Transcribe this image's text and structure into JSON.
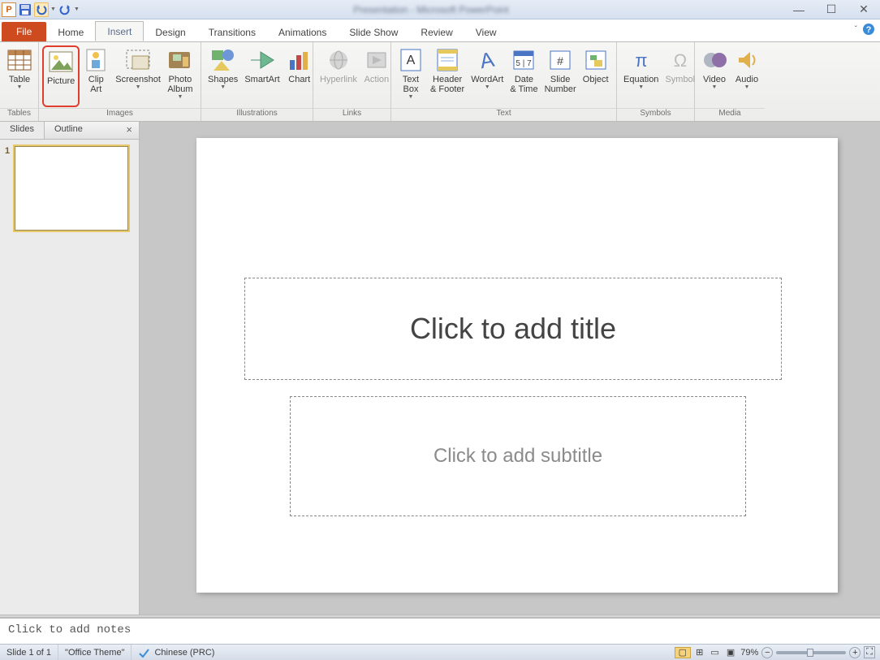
{
  "title_text_blurred": "Presentation - Microsoft PowerPoint",
  "tabs": {
    "file": "File",
    "home": "Home",
    "insert": "Insert",
    "design": "Design",
    "transitions": "Transitions",
    "animations": "Animations",
    "slideshow": "Slide Show",
    "review": "Review",
    "view": "View"
  },
  "ribbon": {
    "groups": {
      "tables": "Tables",
      "images": "Images",
      "illustrations": "Illustrations",
      "links": "Links",
      "text": "Text",
      "symbols": "Symbols",
      "media": "Media"
    },
    "items": {
      "table": "Table",
      "picture": "Picture",
      "clipart": "Clip\nArt",
      "screenshot": "Screenshot",
      "photoalbum": "Photo\nAlbum",
      "shapes": "Shapes",
      "smartart": "SmartArt",
      "chart": "Chart",
      "hyperlink": "Hyperlink",
      "action": "Action",
      "textbox": "Text\nBox",
      "headerfooter": "Header\n& Footer",
      "wordart": "WordArt",
      "datetime": "Date\n& Time",
      "slidenumber": "Slide\nNumber",
      "object": "Object",
      "equation": "Equation",
      "symbol": "Symbol",
      "video": "Video",
      "audio": "Audio"
    }
  },
  "sidepanel": {
    "slides": "Slides",
    "outline": "Outline",
    "slide_number": "1"
  },
  "slide": {
    "title_placeholder": "Click to add title",
    "subtitle_placeholder": "Click to add subtitle"
  },
  "notes_placeholder": "Click to add notes",
  "status": {
    "slide": "Slide 1 of 1",
    "theme": "\"Office Theme\"",
    "lang": "Chinese (PRC)",
    "zoom": "79%"
  },
  "icons": {
    "pp": "P"
  }
}
